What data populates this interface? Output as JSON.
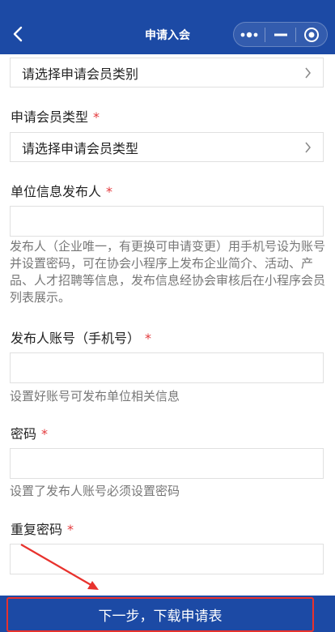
{
  "header": {
    "title": "申请入会",
    "back_icon": "chevron-left-icon",
    "menu_icons": [
      "more-dots-icon",
      "minimize-icon",
      "close-target-icon"
    ]
  },
  "form": {
    "member_category": {
      "placeholder": "请选择申请会员类别"
    },
    "member_type": {
      "label": "申请会员类型",
      "required_mark": "*",
      "placeholder": "请选择申请会员类型"
    },
    "publisher": {
      "label": "单位信息发布人",
      "required_mark": "*",
      "value": "",
      "hint": "发布人（企业唯一，有更换可申请变更）用手机号设为账号并设置密码，可在协会小程序上发布企业简介、活动、产品、人才招聘等信息，发布信息经协会审核后在小程序会员列表展示。"
    },
    "publisher_account": {
      "label": "发布人账号（手机号）",
      "required_mark": "*",
      "value": "",
      "hint": "设置好账号可发布单位相关信息"
    },
    "password": {
      "label": "密码",
      "required_mark": "*",
      "value": "",
      "hint": "设置了发布人账号必须设置密码"
    },
    "confirm_password": {
      "label": "重复密码",
      "required_mark": "*",
      "value": ""
    }
  },
  "footer": {
    "next_button": "下一步，下载申请表"
  },
  "colors": {
    "primary": "#1c4aa5",
    "required": "#e4393c",
    "annotation": "#e8322d"
  }
}
